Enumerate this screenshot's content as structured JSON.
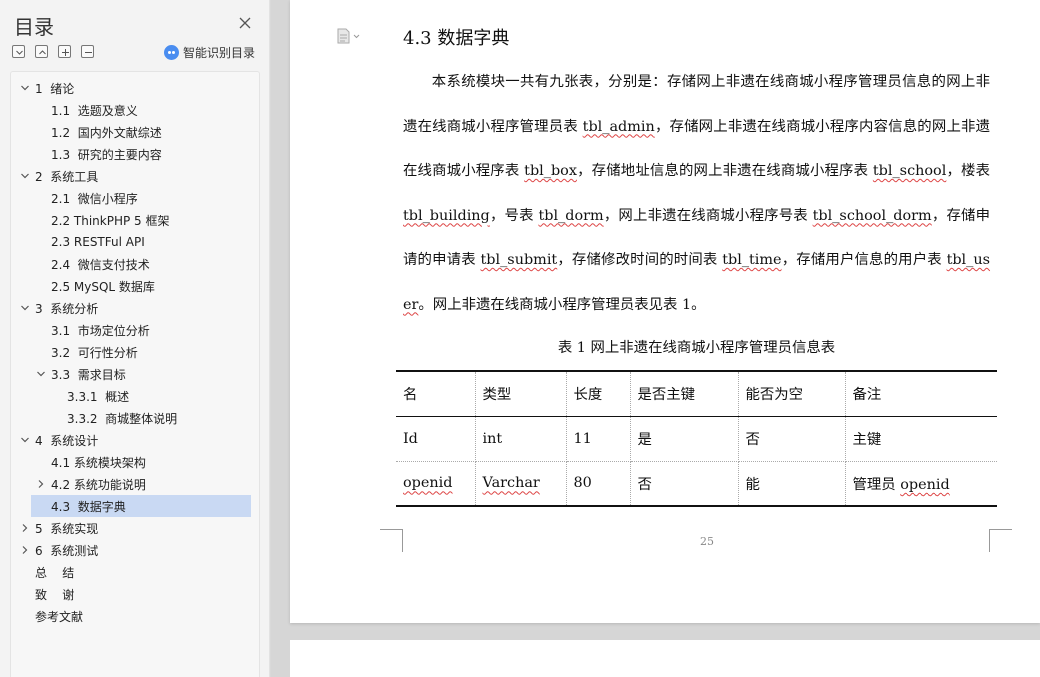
{
  "toc": {
    "title": "目录",
    "smart_label": "智能识别目录",
    "items": [
      {
        "label": "1  绪论",
        "expanded": true
      },
      {
        "label": "1.1  选题及意义"
      },
      {
        "label": "1.2  国内外文献综述"
      },
      {
        "label": "1.3  研究的主要内容"
      },
      {
        "label": "2  系统工具",
        "expanded": true
      },
      {
        "label": "2.1  微信小程序"
      },
      {
        "label": "2.2 ThinkPHP 5 框架"
      },
      {
        "label": "2.3 RESTFul API"
      },
      {
        "label": "2.4  微信支付技术"
      },
      {
        "label": "2.5 MySQL 数据库"
      },
      {
        "label": "3  系统分析",
        "expanded": true
      },
      {
        "label": "3.1  市场定位分析"
      },
      {
        "label": "3.2  可行性分析"
      },
      {
        "label": "3.3  需求目标",
        "expanded": true
      },
      {
        "label": "3.3.1  概述"
      },
      {
        "label": "3.3.2  商城整体说明"
      },
      {
        "label": "4  系统设计",
        "expanded": true
      },
      {
        "label": "4.1 系统模块架构"
      },
      {
        "label": "4.2 系统功能说明",
        "expanded": false
      },
      {
        "label": "4.3  数据字典",
        "selected": true
      },
      {
        "label": "5  系统实现",
        "expanded": false
      },
      {
        "label": "6  系统测试",
        "expanded": false
      },
      {
        "label": "总    结"
      },
      {
        "label": "致    谢"
      },
      {
        "label": "参考文献"
      }
    ]
  },
  "doc": {
    "heading": "4.3  数据字典",
    "para": [
      {
        "t": "本系统模块一共有九张表，分别是：存储网上非遗在线商城小程序管理员信息的网上非遗在线商城小程序管理员表 "
      },
      {
        "t": "tbl_admin",
        "w": true
      },
      {
        "t": "，存储网上非遗在线商城小程序内容信息的网上非遗在线商城小程序表 "
      },
      {
        "t": "tbl_box",
        "w": true
      },
      {
        "t": "，存储地址信息的网上非遗在线商城小程序表 "
      },
      {
        "t": "tbl_school",
        "w": true
      },
      {
        "t": "，楼表 "
      },
      {
        "t": "tbl_building",
        "w": true
      },
      {
        "t": "，号表 "
      },
      {
        "t": "tbl_dorm",
        "w": true
      },
      {
        "t": "，网上非遗在线商城小程序号表 "
      },
      {
        "t": "tbl_school_dorm",
        "w": true
      },
      {
        "t": "，存储申请的申请表 "
      },
      {
        "t": "tbl_submit",
        "w": true
      },
      {
        "t": "，存储修改时间的时间表 "
      },
      {
        "t": "tbl_time",
        "w": true
      },
      {
        "t": "，存储用户信息的用户表 "
      },
      {
        "t": "tbl_user",
        "w": true
      },
      {
        "t": "。网上非遗在线商城小程序管理员表见表 1。"
      }
    ],
    "caption": "表 1  网上非遗在线商城小程序管理员信息表",
    "table": [
      [
        {
          "t": "名"
        },
        {
          "t": "类型"
        },
        {
          "t": "长度"
        },
        {
          "t": "是否主键"
        },
        {
          "t": "能否为空"
        },
        {
          "t": "备注"
        }
      ],
      [
        {
          "t": "Id"
        },
        {
          "t": "int"
        },
        {
          "t": "11"
        },
        {
          "t": "是"
        },
        {
          "t": "否"
        },
        {
          "t": "主键"
        }
      ],
      [
        {
          "t": "openid",
          "w": true
        },
        {
          "t": "Varchar",
          "w": true
        },
        {
          "t": "80"
        },
        {
          "t": "否"
        },
        {
          "t": "能"
        },
        {
          "t": "管理员 openid",
          "w2": true
        }
      ]
    ],
    "page_number": "25"
  }
}
